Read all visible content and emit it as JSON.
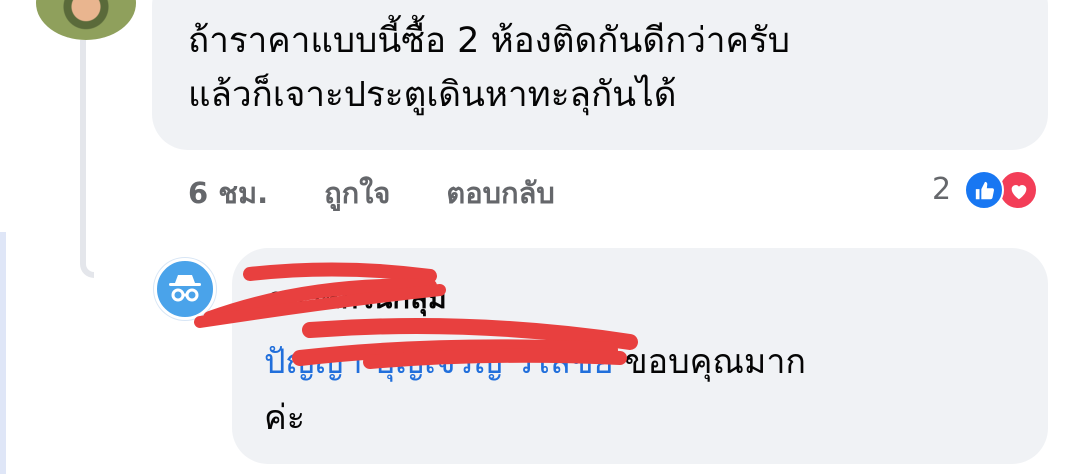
{
  "comment": {
    "lines": [
      "ถ้าราคาแบบนี้ซื้อ 2 ห้องติดกันดีกว่าครับ",
      "แล้วก็เจาะประตูเดินหาทะลุกันได้"
    ],
    "time": "6 ชม.",
    "like_label": "ถูกใจ",
    "reply_label": "ตอบกลับ",
    "reaction_count": "2",
    "reaction_icons": [
      "like-icon",
      "love-icon"
    ]
  },
  "reply": {
    "author": "สมาชิกในกลุ่ม",
    "mention": "ปัญญา บุญเจริญ วิไลชัย",
    "text": " ขอบคุณมาก",
    "text_line2": "ค่ะ",
    "avatar_icon": "anonymous-member-icon"
  },
  "colors": {
    "bubble": "#f0f2f5",
    "mention": "#216fdb",
    "meta": "#65676b",
    "redaction": "#e8403f"
  }
}
